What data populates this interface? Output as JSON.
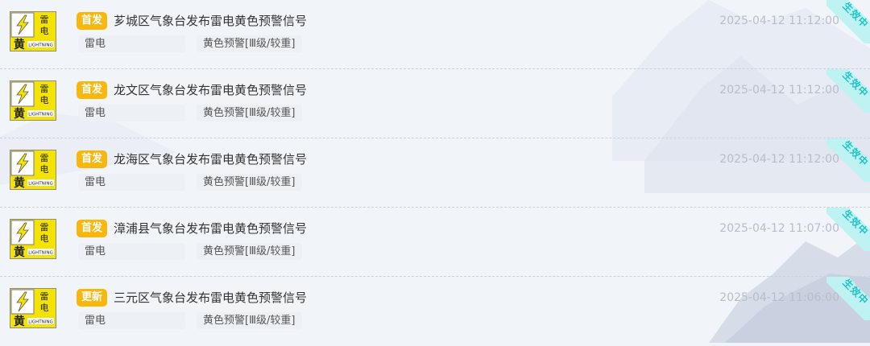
{
  "colors": {
    "badge": "#f8b70d",
    "ribbon": "#bff2f2",
    "ribbon_text": "#20c3c9",
    "icon_bg": "#f4e300"
  },
  "warning_icon": {
    "name": "lightning-yellow-warning-icon",
    "char_top": "雷",
    "char_mid": "电",
    "char_level": "黄",
    "latin": "LIGHTNING"
  },
  "items": [
    {
      "badge": "首发",
      "title": "芗城区气象台发布雷电黄色预警信号",
      "time": "2025-04-12 11:12:00",
      "type": "雷电",
      "level": "黄色预警[Ⅲ级/较重]",
      "status": "生效中"
    },
    {
      "badge": "首发",
      "title": "龙文区气象台发布雷电黄色预警信号",
      "time": "2025-04-12 11:12:00",
      "type": "雷电",
      "level": "黄色预警[Ⅲ级/较重]",
      "status": "生效中"
    },
    {
      "badge": "首发",
      "title": "龙海区气象台发布雷电黄色预警信号",
      "time": "2025-04-12 11:12:00",
      "type": "雷电",
      "level": "黄色预警[Ⅲ级/较重]",
      "status": "生效中"
    },
    {
      "badge": "首发",
      "title": "漳浦县气象台发布雷电黄色预警信号",
      "time": "2025-04-12 11:07:00",
      "type": "雷电",
      "level": "黄色预警[Ⅲ级/较重]",
      "status": "生效中"
    },
    {
      "badge": "更新",
      "title": "三元区气象台发布雷电黄色预警信号",
      "time": "2025-04-12 11:06:00",
      "type": "雷电",
      "level": "黄色预警[Ⅲ级/较重]",
      "status": "生效中"
    }
  ]
}
